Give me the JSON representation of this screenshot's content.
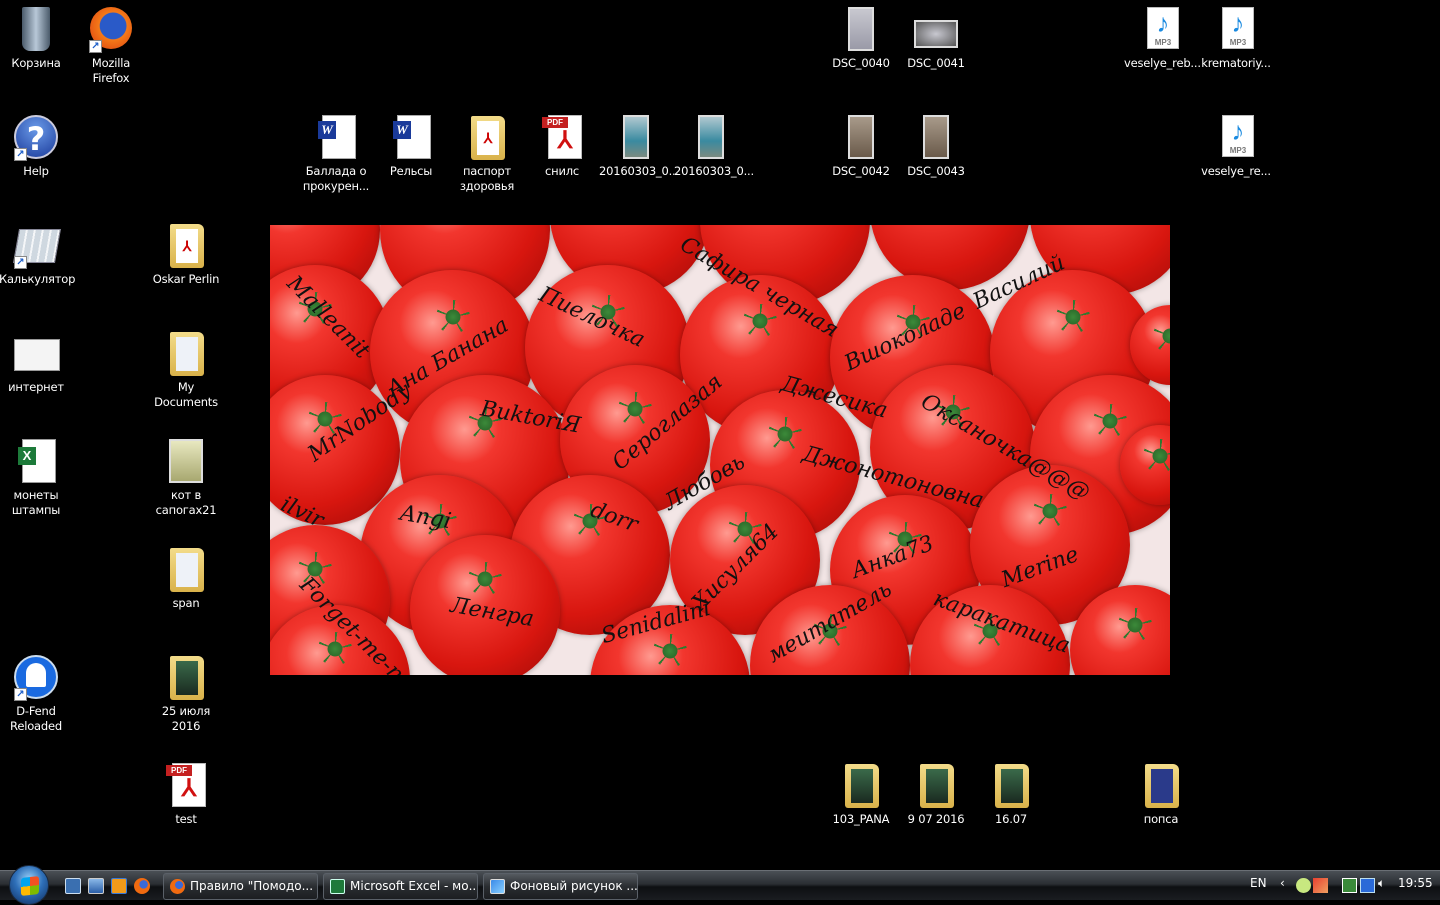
{
  "desktop": {
    "icons": [
      {
        "label": "Корзина",
        "type": "recycle-bin"
      },
      {
        "label": "Mozilla Firefox",
        "type": "firefox",
        "shortcut": true
      },
      {
        "label": "Help",
        "type": "help",
        "shortcut": true
      },
      {
        "label": "Калькулятор",
        "type": "calculator",
        "shortcut": true
      },
      {
        "label": "интернет",
        "type": "image-doc"
      },
      {
        "label": "монеты штампы",
        "type": "excel"
      },
      {
        "label": "D-Fend Reloaded",
        "type": "dfend",
        "shortcut": true
      },
      {
        "label": "Oskar Perlin",
        "type": "folder-pdf"
      },
      {
        "label": "My Documents",
        "type": "folder"
      },
      {
        "label": "кот в сапогах21",
        "type": "photo-light"
      },
      {
        "label": "span",
        "type": "folder"
      },
      {
        "label": "25 июля 2016",
        "type": "folder-photo"
      },
      {
        "label": "test",
        "type": "pdf"
      },
      {
        "label": "Баллада о прокурен...",
        "type": "word"
      },
      {
        "label": "Рельсы",
        "type": "word"
      },
      {
        "label": "паспорт здоровья",
        "type": "folder-pdf"
      },
      {
        "label": "снилс",
        "type": "pdf"
      },
      {
        "label": "20160303_0...",
        "type": "photo-people"
      },
      {
        "label": "20160303_0...",
        "type": "photo-people"
      },
      {
        "label": "DSC_0040",
        "type": "photo-paper"
      },
      {
        "label": "DSC_0041",
        "type": "photo-paper-wide"
      },
      {
        "label": "DSC_0042",
        "type": "photo-paper-dark"
      },
      {
        "label": "DSC_0043",
        "type": "photo-paper-dark"
      },
      {
        "label": "veselye_reb...",
        "type": "mp3"
      },
      {
        "label": "krematoriy...",
        "type": "mp3"
      },
      {
        "label": "veselye_re...",
        "type": "mp3"
      },
      {
        "label": "103_PANA",
        "type": "folder-photo"
      },
      {
        "label": "9 07 2016",
        "type": "folder-photo"
      },
      {
        "label": "16.07",
        "type": "folder-photo"
      },
      {
        "label": "попса",
        "type": "folder-blue"
      }
    ]
  },
  "wallpaper": {
    "names": [
      "Malleanit",
      "Ана Банана",
      "Пиелочка",
      "Сафира черная",
      "Вшоколаде",
      "Василий",
      "MrNobody",
      "BuktoriЯ",
      "Сероглазая",
      "Джесика",
      "Оксаночка@@@",
      "Любовь",
      "Джонотоновна",
      "ilvir",
      "Angi",
      "dorr",
      "Хисуля64",
      "Анка73",
      "Merine",
      "Forget-me-not",
      "Ленгра",
      "Senidalini",
      "меитатель",
      "каракатица"
    ]
  },
  "taskbar": {
    "quick_launch": [
      "show-desktop",
      "switch-windows",
      "media-player",
      "firefox"
    ],
    "tasks": [
      {
        "label": "Правило \"Помодо...",
        "icon": "firefox"
      },
      {
        "label": "Microsoft Excel - мо...",
        "icon": "excel"
      },
      {
        "label": "Фоновый рисунок ...",
        "icon": "personalize"
      }
    ],
    "language": "EN",
    "clock": "19:55"
  }
}
